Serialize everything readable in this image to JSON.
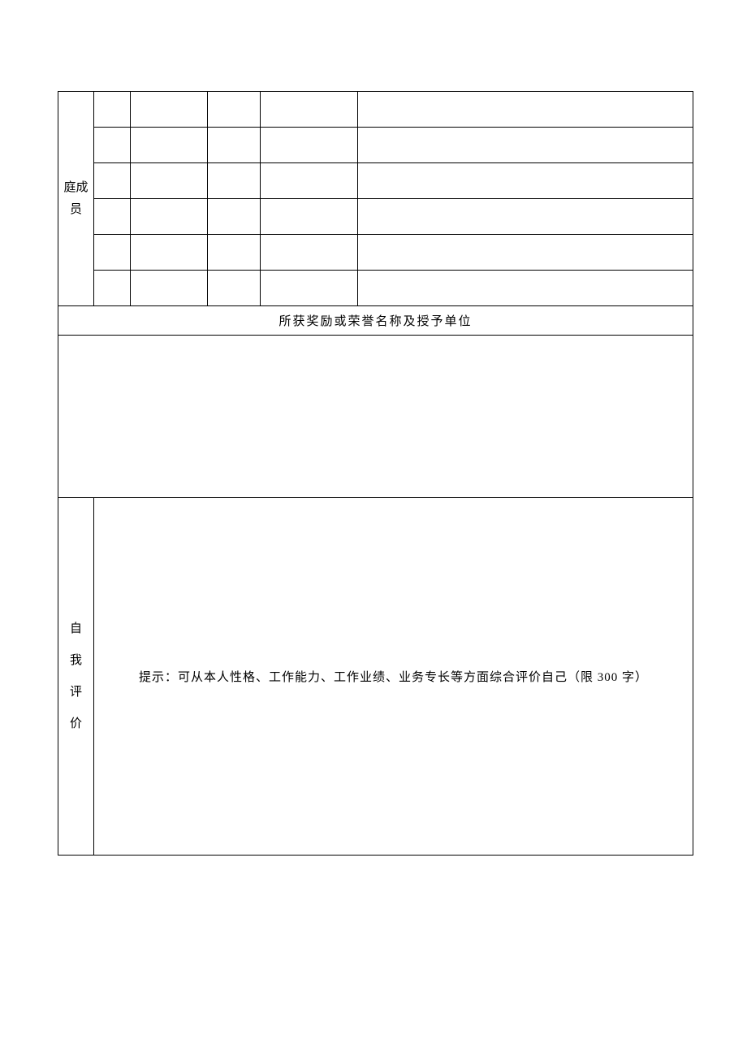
{
  "family": {
    "label_line1": "庭成",
    "label_line2": "员",
    "rows": [
      {
        "c1": "",
        "c2": "",
        "c3": "",
        "c4": "",
        "c5": ""
      },
      {
        "c1": "",
        "c2": "",
        "c3": "",
        "c4": "",
        "c5": ""
      },
      {
        "c1": "",
        "c2": "",
        "c3": "",
        "c4": "",
        "c5": ""
      },
      {
        "c1": "",
        "c2": "",
        "c3": "",
        "c4": "",
        "c5": ""
      },
      {
        "c1": "",
        "c2": "",
        "c3": "",
        "c4": "",
        "c5": ""
      },
      {
        "c1": "",
        "c2": "",
        "c3": "",
        "c4": "",
        "c5": ""
      }
    ]
  },
  "awards": {
    "header": "所获奖励或荣誉名称及授予单位",
    "content": ""
  },
  "self_evaluation": {
    "label_c1": "自",
    "label_c2": "我",
    "label_c3": "评",
    "label_c4": "价",
    "hint": "提示：可从本人性格、工作能力、工作业绩、业务专长等方面综合评价自己（限 300 字）"
  }
}
